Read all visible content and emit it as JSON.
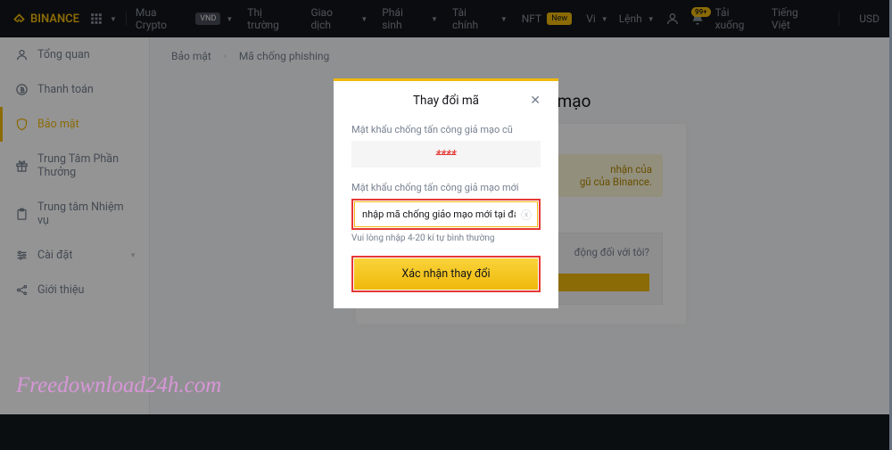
{
  "header": {
    "brand": "BINANCE",
    "nav": {
      "buy_crypto": "Mua Crypto",
      "vnd": "VND",
      "market": "Thị trường",
      "trade": "Giao dịch",
      "derivatives": "Phái sinh",
      "finance": "Tài chính",
      "nft": "NFT",
      "new": "New"
    },
    "right": {
      "vi": "Vi",
      "orders": "Lệnh",
      "notification_badge": "99+",
      "download": "Tải xuống",
      "lang": "Tiếng Việt",
      "currency": "USD"
    }
  },
  "sidebar": {
    "overview": "Tổng quan",
    "payment": "Thanh toán",
    "security": "Bảo mật",
    "reward": "Trung Tâm Phần Thưởng",
    "task": "Trung tâm Nhiệm vụ",
    "settings": "Cài đặt",
    "about": "Giới thiệu"
  },
  "breadcrumb": {
    "security": "Bảo mật",
    "anti": "Mã chống phishing"
  },
  "content": {
    "title": "Mã chống giả mạo",
    "info_l1": "nhận của",
    "info_l2": "gũ của Binance.",
    "question": "động đối với tôi?",
    "btn": " "
  },
  "modal": {
    "title": "Thay đổi mã",
    "old_label": "Mật khẩu chống tấn công giả mạo cũ",
    "old_value": "****",
    "new_label": "Mật khẩu chống tấn công giả mạo mới",
    "new_value": "nhập mã chống giảo mạo mới tại đây",
    "hint": "Vui lòng nhập 4-20 kí tự bình thường",
    "confirm": "Xác nhận thay đổi"
  },
  "watermark": "Freedownload24h.com"
}
